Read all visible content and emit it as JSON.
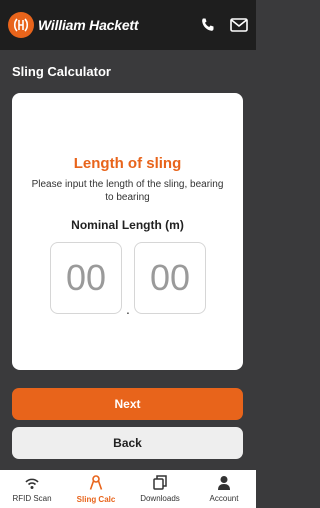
{
  "header": {
    "brand": "William Hackett",
    "icons": [
      "phone-icon",
      "mail-icon"
    ]
  },
  "page": {
    "title": "Sling Calculator"
  },
  "card": {
    "heading": "Length of sling",
    "description": "Please input the length of the sling, bearing to bearing",
    "field_label": "Nominal Length (m)",
    "whole_placeholder": "00",
    "separator": ".",
    "fraction_placeholder": "00"
  },
  "buttons": {
    "next": "Next",
    "back": "Back"
  },
  "tabs": [
    {
      "label": "RFID Scan",
      "icon": "rfid-icon",
      "active": false
    },
    {
      "label": "Sling Calc",
      "icon": "sling-icon",
      "active": true
    },
    {
      "label": "Downloads",
      "icon": "downloads-icon",
      "active": false
    },
    {
      "label": "Account",
      "icon": "account-icon",
      "active": false
    }
  ],
  "colors": {
    "accent": "#e8641b",
    "background": "#3a3a3c",
    "header": "#1e1e1e"
  }
}
